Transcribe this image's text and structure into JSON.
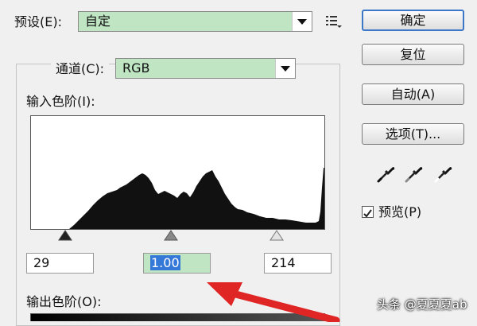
{
  "preset": {
    "label": "预设(E):",
    "value": "自定"
  },
  "buttons": {
    "ok": "确定",
    "reset": "复位",
    "auto": "自动(A)",
    "options": "选项(T)..."
  },
  "channel": {
    "label": "通道(C):",
    "value": "RGB"
  },
  "input_levels": {
    "label": "输入色阶(I):",
    "black": "29",
    "gamma": "1.00",
    "white": "214"
  },
  "output_levels": {
    "label": "输出色阶(O):"
  },
  "preview": {
    "label": "预览(P)",
    "checked": true
  },
  "watermark": "头条 @夏夏夏ab",
  "icons": {
    "preset_menu": "list-menu-icon",
    "black_eyedropper": "eyedropper-icon",
    "gray_eyedropper": "eyedropper-icon",
    "white_eyedropper": "eyedropper-icon",
    "annotation": "red-arrow-icon"
  },
  "colors": {
    "field_highlight": "#bfe5c3",
    "selection": "#3479d8",
    "arrow": "#e02525",
    "primary_border": "#3d77c7"
  }
}
